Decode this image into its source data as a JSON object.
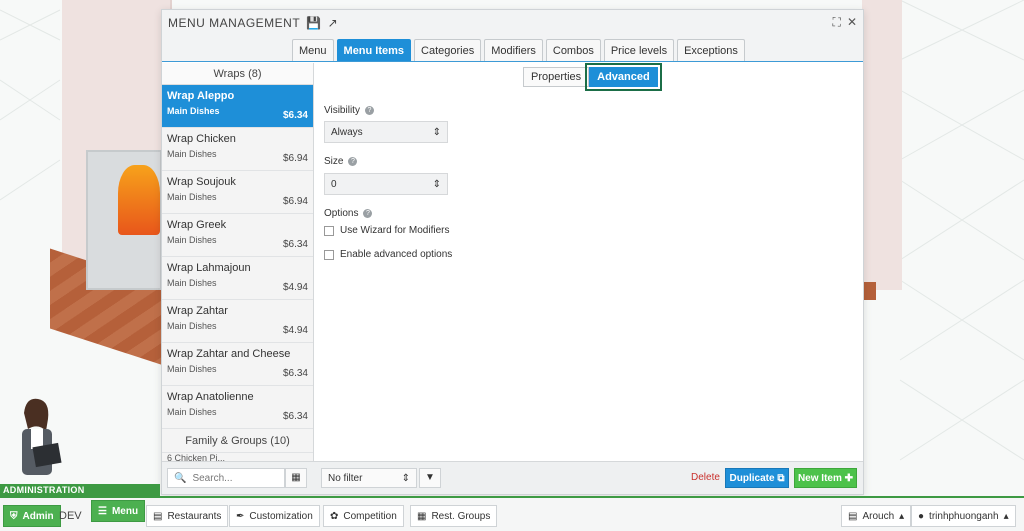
{
  "modal": {
    "title": "MENU MANAGEMENT",
    "tabs": [
      "Menu",
      "Menu Items",
      "Categories",
      "Modifiers",
      "Combos",
      "Price levels",
      "Exceptions"
    ],
    "active_tab": "Menu Items"
  },
  "list": {
    "group1": "Wraps (8)",
    "items": [
      {
        "name": "Wrap Aleppo",
        "category": "Main Dishes",
        "price": "$6.34"
      },
      {
        "name": "Wrap Chicken",
        "category": "Main Dishes",
        "price": "$6.94"
      },
      {
        "name": "Wrap Soujouk",
        "category": "Main Dishes",
        "price": "$6.94"
      },
      {
        "name": "Wrap Greek",
        "category": "Main Dishes",
        "price": "$6.34"
      },
      {
        "name": "Wrap Lahmajoun",
        "category": "Main Dishes",
        "price": "$4.94"
      },
      {
        "name": "Wrap Zahtar",
        "category": "Main Dishes",
        "price": "$4.94"
      },
      {
        "name": "Wrap Zahtar and Cheese",
        "category": "Main Dishes",
        "price": "$6.34"
      },
      {
        "name": "Wrap Anatolienne",
        "category": "Main Dishes",
        "price": "$6.34"
      }
    ],
    "group2": "Family & Groups (10)",
    "partial_item": "6 Chicken Pi..."
  },
  "subtabs": {
    "properties": "Properties",
    "advanced": "Advanced"
  },
  "form": {
    "visibility_label": "Visibility",
    "visibility_value": "Always",
    "size_label": "Size",
    "size_value": "0",
    "options_label": "Options",
    "opt_wizard": "Use Wizard for Modifiers",
    "opt_advanced": "Enable advanced options"
  },
  "footer": {
    "search_placeholder": "Search...",
    "filter_value": "No filter",
    "delete": "Delete",
    "duplicate": "Duplicate",
    "new_item": "New Item"
  },
  "admin": {
    "label": "ADMINISTRATION",
    "admin_btn": "Admin",
    "dev": "DEV",
    "menu": "Menu",
    "restaurants": "Restaurants",
    "customization": "Customization",
    "competition": "Competition",
    "rest_groups": "Rest. Groups",
    "location": "Arouch",
    "user": "trinhphuonganh"
  }
}
